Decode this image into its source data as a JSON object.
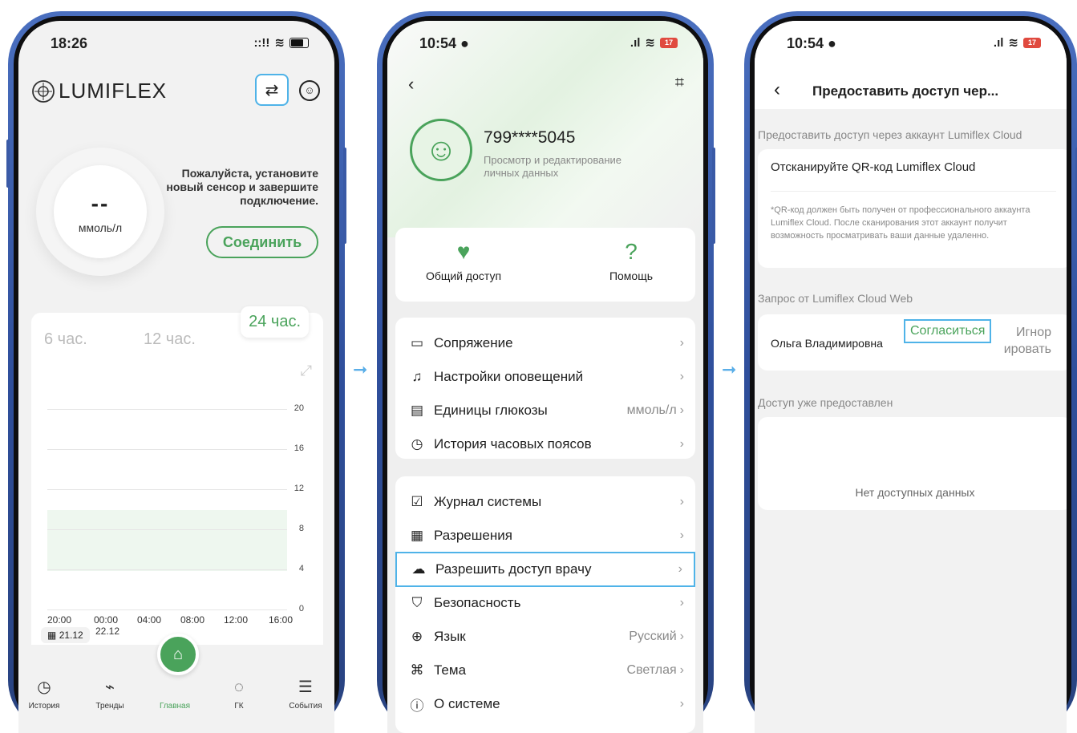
{
  "screen1": {
    "time": "18:26",
    "brand": "LUMIFLEX",
    "gauge_value": "--",
    "gauge_unit": "ммоль/л",
    "message": "Пожалуйста, установите новый сенсор и завершите подключение.",
    "connect_label": "Соединить",
    "range_tabs": [
      "6 час.",
      "12 час.",
      "24 час."
    ],
    "y_ticks": [
      "20",
      "16",
      "12",
      "8",
      "4",
      "0"
    ],
    "x_ticks": [
      "20:00",
      "00:00",
      "04:00",
      "08:00",
      "12:00",
      "16:00"
    ],
    "date_start": "21.12",
    "date_next": "22.12",
    "tabs": [
      "История",
      "Тренды",
      "Главная",
      "ГК",
      "События"
    ]
  },
  "screen2": {
    "time": "10:54",
    "battery": "17",
    "phone_number": "799****5045",
    "profile_sub": "Просмотр и редактирование личных данных",
    "quick": [
      "Общий доступ",
      "Помощь"
    ],
    "group1": [
      {
        "label": "Сопряжение",
        "value": "",
        "icon": "link-icon"
      },
      {
        "label": "Настройки оповещений",
        "value": "",
        "icon": "bell-icon"
      },
      {
        "label": "Единицы глюкозы",
        "value": "ммоль/л",
        "icon": "drop-icon"
      },
      {
        "label": "История часовых поясов",
        "value": "",
        "icon": "clock-icon"
      }
    ],
    "group2": [
      {
        "label": "Журнал системы",
        "value": "",
        "icon": "log-icon"
      },
      {
        "label": "Разрешения",
        "value": "",
        "icon": "permissions-icon"
      },
      {
        "label": "Разрешить доступ врачу",
        "value": "",
        "icon": "cloud-upload-icon"
      },
      {
        "label": "Безопасность",
        "value": "",
        "icon": "shield-icon"
      },
      {
        "label": "Язык",
        "value": "Русский",
        "icon": "globe-icon"
      },
      {
        "label": "Тема",
        "value": "Светлая",
        "icon": "theme-icon"
      },
      {
        "label": "О системе",
        "value": "",
        "icon": "info-icon"
      }
    ]
  },
  "screen3": {
    "time": "10:54",
    "battery": "17",
    "title": "Предоставить доступ чер...",
    "section1": "Предоставить доступ через аккаунт Lumiflex Cloud",
    "scan_label": "Отсканируйте QR-код Lumiflex Cloud",
    "scan_note": "*QR-код должен быть получен от профессионального аккаунта Lumiflex Cloud. После сканирования этот аккаунт получит возможность просматривать ваши данные удаленно.",
    "section2": "Запрос от Lumiflex Cloud Web",
    "requester": "Ольга Владимировна",
    "agree": "Согласиться",
    "ignore": "Игнорировать",
    "ignore_line1": "Игнор",
    "ignore_line2": "ировать",
    "section3": "Доступ уже предоставлен",
    "empty": "Нет доступных данных"
  },
  "colors": {
    "accent_green": "#4aa35b",
    "highlight_blue": "#4fb3e8",
    "frame_blue": "#2f4f9c"
  }
}
